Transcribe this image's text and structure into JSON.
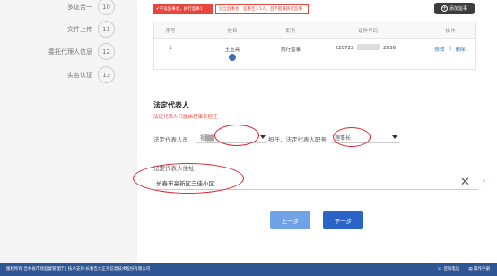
{
  "sidebar": {
    "steps": [
      {
        "label": "多证合一",
        "num": "10"
      },
      {
        "label": "文件上传",
        "num": "11"
      },
      {
        "label": "委托代理人信息",
        "num": "12"
      },
      {
        "label": "实名认证",
        "num": "13"
      }
    ]
  },
  "board": {
    "tag_red": "✔不设监事会，执行监事1",
    "tag_outline": "设立监事会，监事至少1人，且不能兼执行监事",
    "add_label": "添加监事",
    "table": {
      "headers": [
        "序号",
        "姓名",
        "职务",
        "证件号码",
        "操作"
      ],
      "row": {
        "index": "1",
        "name": "王玉亮",
        "position": "执行监事",
        "id_prefix": "220722",
        "id_suffix": "2836",
        "edit": "修改",
        "sep": "|",
        "delete": "删除"
      }
    }
  },
  "legal_rep": {
    "title": "法定代表人",
    "hint": "法定代表人只能由理事长担任",
    "rep_label": "法定代表人员",
    "rep_value": "祖▒▒",
    "role_label": "担任，法定代表人职务",
    "role_value": "理事长",
    "address_label": "法定代表人住址",
    "address_value": "长春市高新区三佳小区",
    "required_mark": "*"
  },
  "buttons": {
    "prev": "上一步",
    "next": "下一步"
  },
  "footer": {
    "left": "版权所有:吉林省市场监督管理厅 | 技术支持:长春吉大正元信息技术股份有限公司",
    "phone": "咨询电话",
    "manual": "操作手册"
  },
  "colors": {
    "accent": "#2b64c8",
    "footer": "#2f5594",
    "alert": "#e8453c"
  }
}
